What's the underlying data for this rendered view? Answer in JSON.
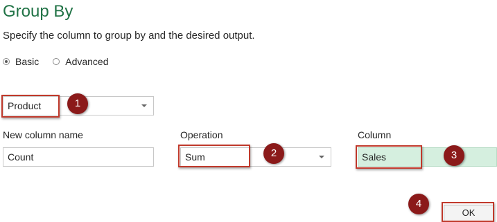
{
  "dialog": {
    "title": "Group By",
    "description": "Specify the column to group by and the desired output."
  },
  "mode": {
    "basic_label": "Basic",
    "advanced_label": "Advanced",
    "selected": "Basic"
  },
  "group_by": {
    "selected_value": "Product"
  },
  "new_column": {
    "label": "New column name",
    "value": "Count"
  },
  "operation": {
    "label": "Operation",
    "selected_value": "Sum"
  },
  "column": {
    "label": "Column",
    "selected_value": "Sales"
  },
  "ok_label": "OK",
  "annotations": {
    "step1": "1",
    "step2": "2",
    "step3": "3",
    "step4": "4"
  },
  "colors": {
    "title": "#217346",
    "highlight_border": "#c0392b",
    "badge_fill": "#8b1a1a",
    "column_fill": "#d5efdf"
  }
}
